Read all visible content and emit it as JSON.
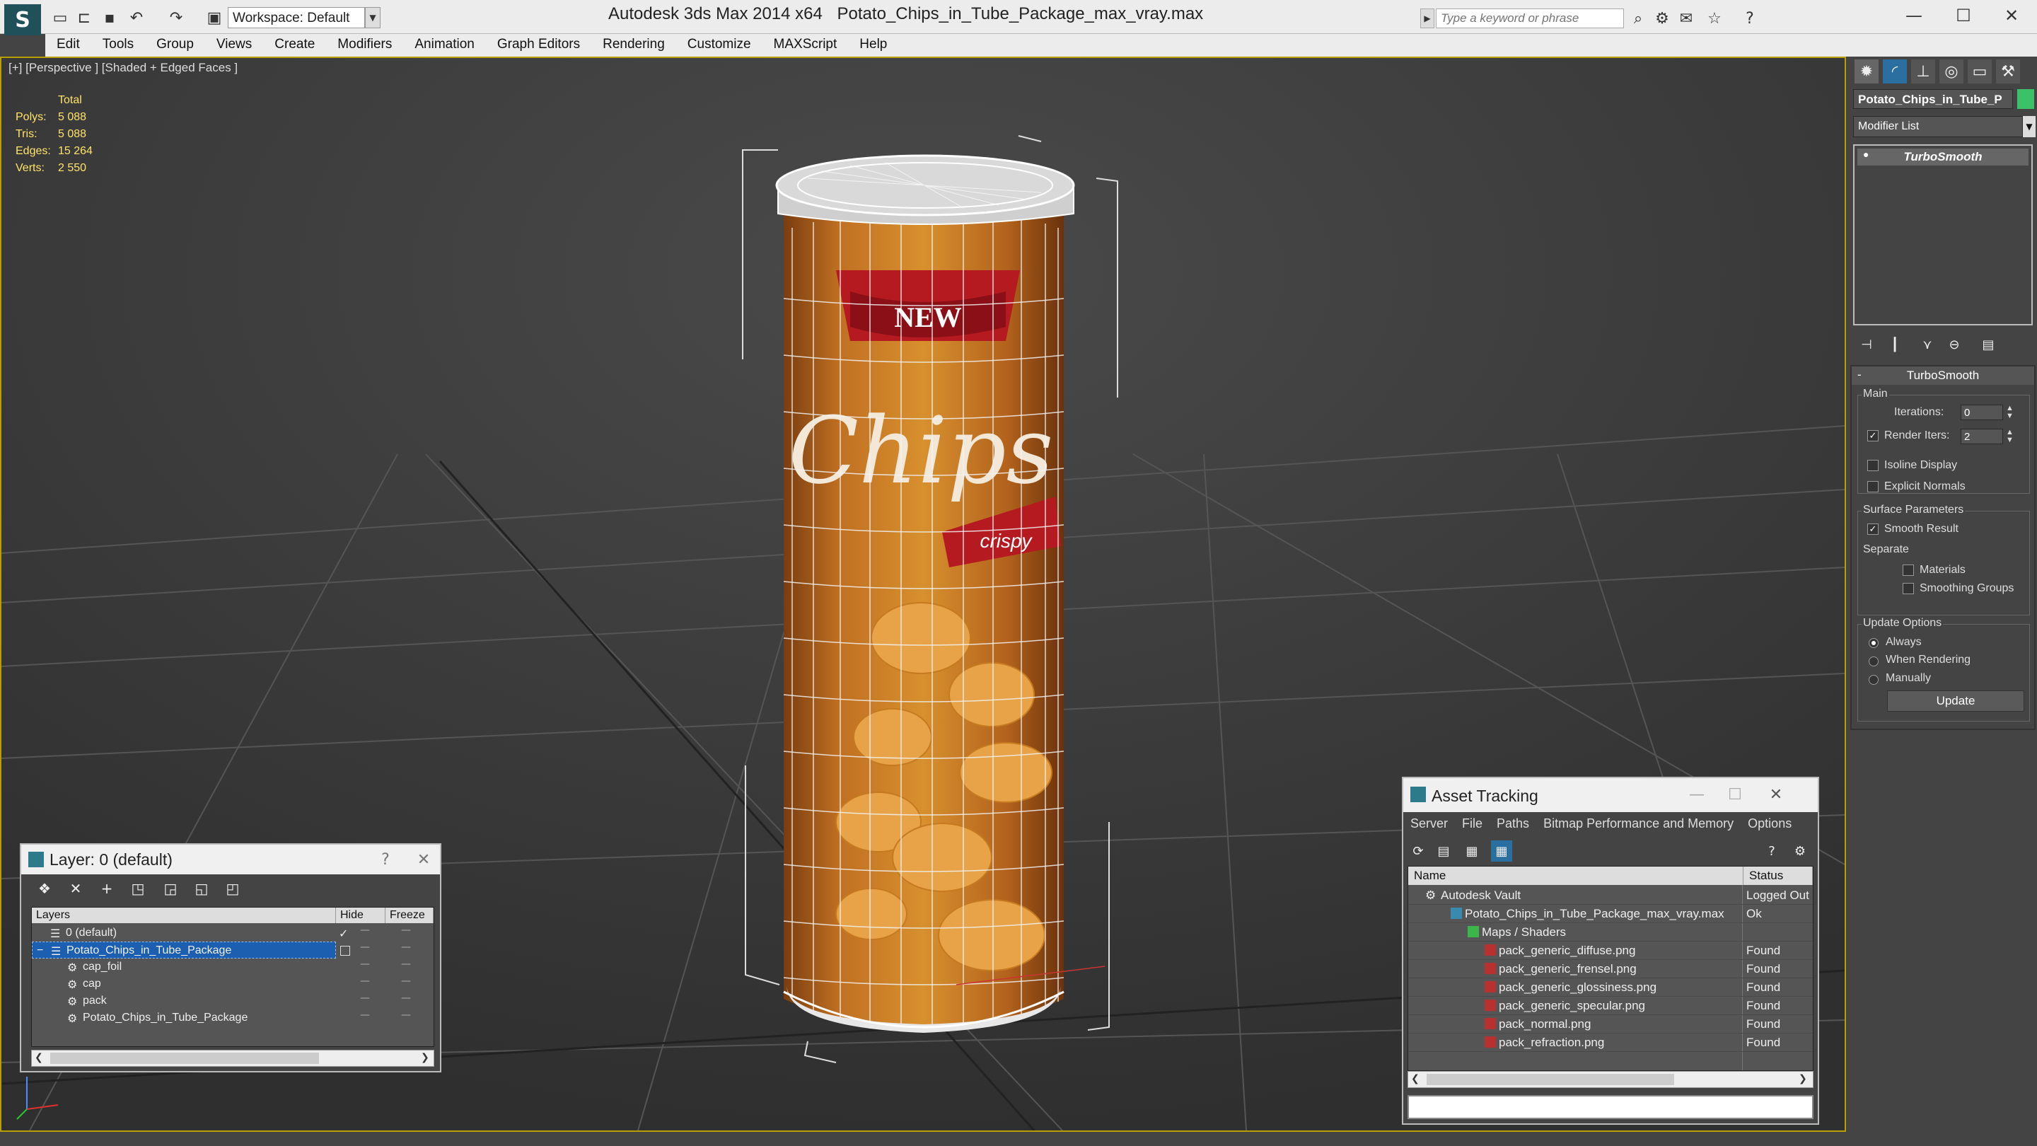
{
  "app": {
    "title": "Autodesk 3ds Max  2014 x64",
    "file": "Potato_Chips_in_Tube_Package_max_vray.max"
  },
  "toolbar": {
    "workspace": "Workspace: Default",
    "search_placeholder": "Type a keyword or phrase"
  },
  "menu": [
    "Edit",
    "Tools",
    "Group",
    "Views",
    "Create",
    "Modifiers",
    "Animation",
    "Graph Editors",
    "Rendering",
    "Customize",
    "MAXScript",
    "Help"
  ],
  "viewport": {
    "label": "[+] [Perspective ] [Shaded + Edged Faces ]",
    "stats_header": "Total",
    "stats": [
      {
        "label": "Polys:",
        "value": "5 088"
      },
      {
        "label": "Tris:",
        "value": "5 088"
      },
      {
        "label": "Edges:",
        "value": "15 264"
      },
      {
        "label": "Verts:",
        "value": "2 550"
      }
    ],
    "product": {
      "brand": "NEW",
      "title": "Chips",
      "tag": "crispy"
    }
  },
  "command_panel": {
    "object_name": "Potato_Chips_in_Tube_P",
    "object_color": "#3cc16a",
    "modifier_list": "Modifier List",
    "stack_item": "TurboSmooth",
    "rollout": {
      "title": "TurboSmooth",
      "collapse": "-",
      "main_label": "Main",
      "iterations_label": "Iterations:",
      "iterations_value": "0",
      "render_iters_label": "Render Iters:",
      "render_iters_value": "2",
      "isoline": "Isoline Display",
      "explicit_normals": "Explicit Normals",
      "surface_params": "Surface Parameters",
      "smooth_result": "Smooth Result",
      "separate": "Separate",
      "materials": "Materials",
      "smoothing_groups": "Smoothing Groups",
      "update_options": "Update Options",
      "always": "Always",
      "when_rendering": "When Rendering",
      "manually": "Manually",
      "update_button": "Update"
    }
  },
  "layer_dialog": {
    "title": "Layer: 0 (default)",
    "help": "?",
    "close": "✕",
    "headers": {
      "layers": "Layers",
      "hide": "Hide",
      "freeze": "Freeze"
    },
    "rows": [
      {
        "name": "0 (default)",
        "level": 1
      },
      {
        "name": "Potato_Chips_in_Tube_Package",
        "level": 1
      },
      {
        "name": "cap_foil",
        "level": 2
      },
      {
        "name": "cap",
        "level": 2
      },
      {
        "name": "pack",
        "level": 2
      },
      {
        "name": "Potato_Chips_in_Tube_Package",
        "level": 2
      }
    ]
  },
  "asset_dialog": {
    "title": "Asset Tracking",
    "menu": [
      "Server",
      "File",
      "Paths",
      "Bitmap Performance and Memory",
      "Options"
    ],
    "headers": {
      "name": "Name",
      "status": "Status"
    },
    "rows": [
      {
        "name": "Autodesk Vault",
        "status": "Logged Out",
        "level": 0
      },
      {
        "name": "Potato_Chips_in_Tube_Package_max_vray.max",
        "status": "Ok",
        "level": 1
      },
      {
        "name": "Maps / Shaders",
        "status": "",
        "level": 2
      },
      {
        "name": "pack_generic_diffuse.png",
        "status": "Found",
        "level": 3
      },
      {
        "name": "pack_generic_frensel.png",
        "status": "Found",
        "level": 3
      },
      {
        "name": "pack_generic_glossiness.png",
        "status": "Found",
        "level": 3
      },
      {
        "name": "pack_generic_specular.png",
        "status": "Found",
        "level": 3
      },
      {
        "name": "pack_normal.png",
        "status": "Found",
        "level": 3
      },
      {
        "name": "pack_refraction.png",
        "status": "Found",
        "level": 3
      }
    ]
  }
}
